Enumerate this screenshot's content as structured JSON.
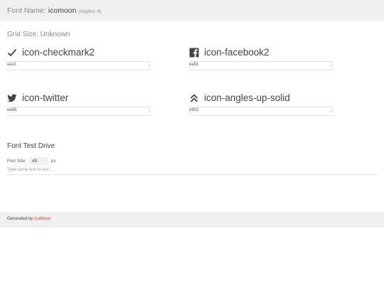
{
  "header": {
    "font_name_label": "Font Name:",
    "font_name": "icomoon",
    "glyph_count": "(Glyphs: 4)"
  },
  "grid_size": "Grid Size: Unknown",
  "glyphs": [
    {
      "name": "icon-checkmark2",
      "code": "ea11",
      "icon": "checkmark-icon"
    },
    {
      "name": "icon-facebook2",
      "code": "ea91",
      "icon": "facebook-icon"
    },
    {
      "name": "icon-twitter",
      "code": "ea96",
      "icon": "twitter-icon"
    },
    {
      "name": "icon-angles-up-solid",
      "code": "e902",
      "icon": "angles-up-icon"
    }
  ],
  "test_drive": {
    "title": "Font Test Drive",
    "font_size_label": "Font Size:",
    "font_size_value": "48",
    "unit": "px",
    "placeholder": "Type some text to test..."
  },
  "footer": {
    "generated_by": "Generated by",
    "link": "IcoMoon"
  },
  "colors": {
    "link": "#d9431e",
    "bar_bg": "#f0f0f0"
  }
}
